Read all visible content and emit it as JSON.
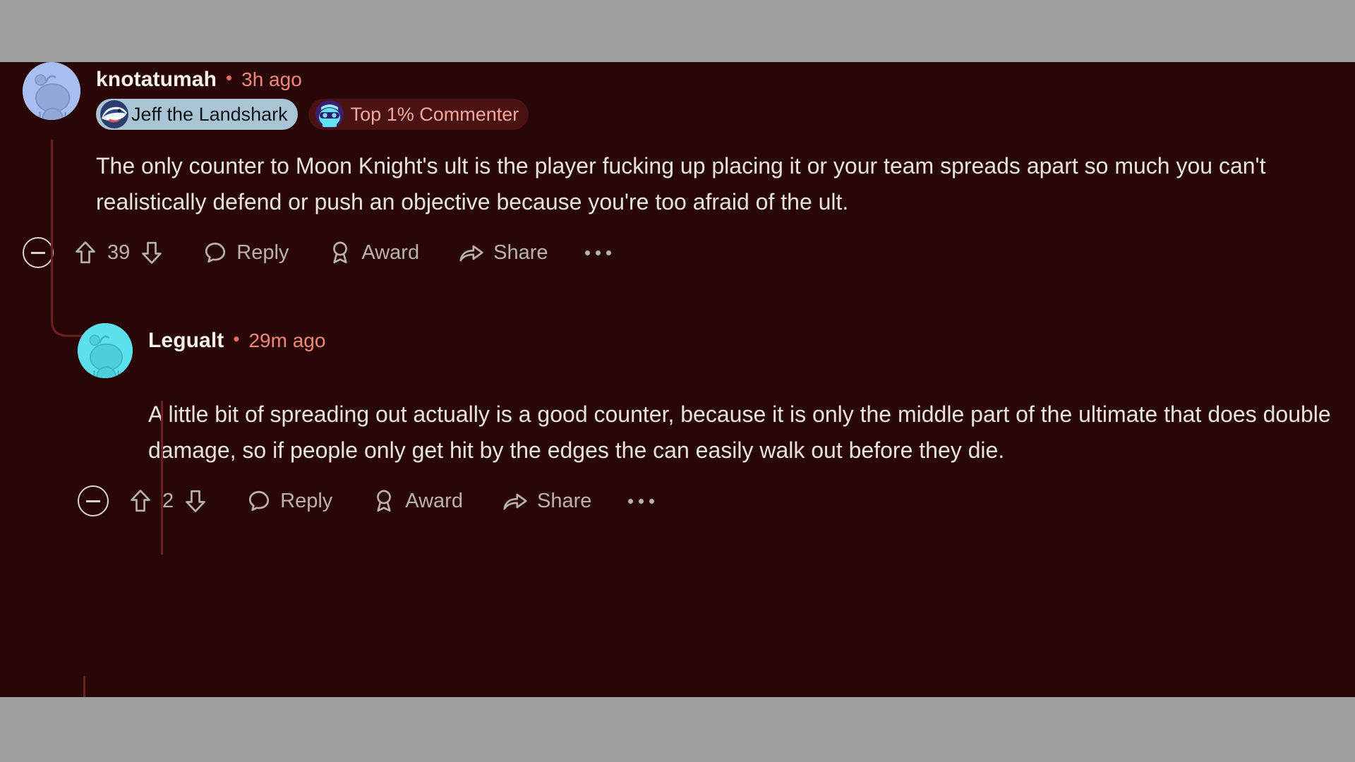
{
  "theme": {
    "page_background": "#9e9e9e",
    "comment_background": "#2a0707",
    "text_primary": "#e6e3e0",
    "username_color": "#f3f0ee",
    "timestamp_color": "#f0877c",
    "action_color": "#b9b2ae",
    "thread_line_color": "#6d2020",
    "flair_badge_background": "#a9c4d4",
    "top_commenter_badge_background": "#4a1212",
    "top_commenter_badge_text": "#f5a79c",
    "avatar_top_color": "#a8bdf0",
    "avatar_reply_color": "#5ce1ec"
  },
  "comments": [
    {
      "id": "top-comment",
      "author": "knotatumah",
      "separator": "•",
      "timestamp": "3h ago",
      "avatar_icon": "snoo-avatar",
      "badges": [
        {
          "type": "flair",
          "icon": "landshark-icon",
          "label": "Jeff the Landshark"
        },
        {
          "type": "achievement",
          "icon": "top-commenter-snoo-icon",
          "label": "Top 1% Commenter"
        }
      ],
      "body": "The only counter to Moon Knight's ult is the player fucking up placing it or your team spreads apart so much you can't realistically defend or push an objective because you're too afraid of the ult.",
      "actions": {
        "collapse_icon": "minus-circle-icon",
        "upvote_icon": "upvote-arrow-icon",
        "score": "39",
        "downvote_icon": "downvote-arrow-icon",
        "reply_icon": "comment-bubble-icon",
        "reply_label": "Reply",
        "award_icon": "award-ribbon-icon",
        "award_label": "Award",
        "share_icon": "share-arrow-icon",
        "share_label": "Share",
        "more_icon": "more-dots-icon"
      }
    },
    {
      "id": "reply-comment",
      "author": "Legualt",
      "separator": "•",
      "timestamp": "29m ago",
      "avatar_icon": "snoo-avatar",
      "badges": [],
      "body": "A little bit of spreading out actually is a good counter, because it is only the middle part of the ultimate that does double damage, so if people only get hit by the edges the can easily walk out before they die.",
      "actions": {
        "collapse_icon": "minus-circle-icon",
        "upvote_icon": "upvote-arrow-icon",
        "score": "2",
        "downvote_icon": "downvote-arrow-icon",
        "reply_icon": "comment-bubble-icon",
        "reply_label": "Reply",
        "award_icon": "award-ribbon-icon",
        "award_label": "Award",
        "share_icon": "share-arrow-icon",
        "share_label": "Share",
        "more_icon": "more-dots-icon"
      }
    }
  ]
}
